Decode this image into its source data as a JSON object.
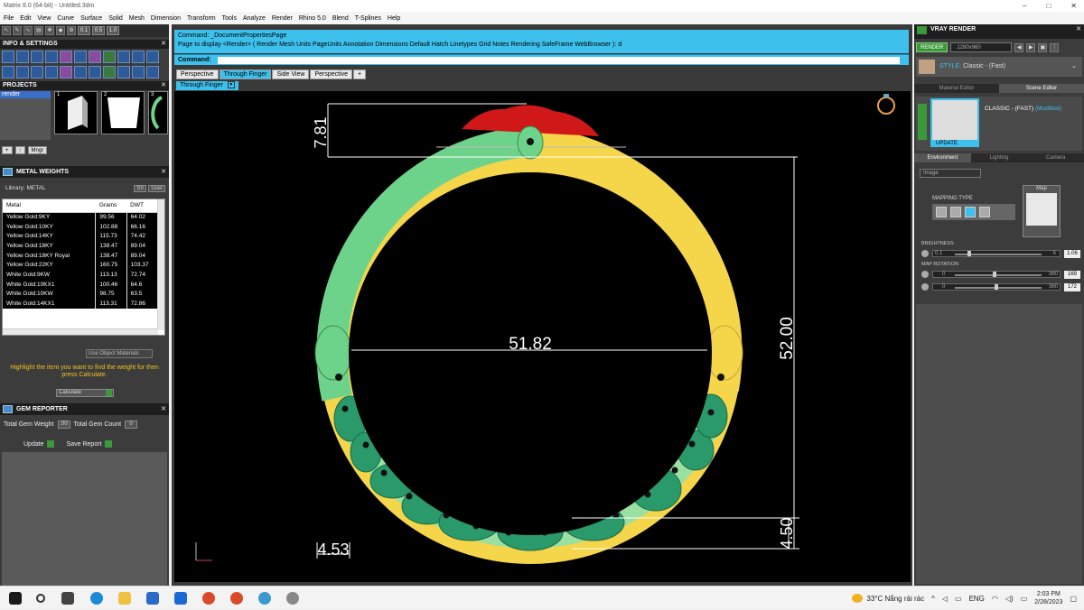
{
  "window": {
    "title": "Matrix 8.0 (64-bit) - Untitled.3dm",
    "controls": [
      "–",
      "□",
      "✕"
    ]
  },
  "menu": [
    "File",
    "Edit",
    "View",
    "Curve",
    "Surface",
    "Solid",
    "Mesh",
    "Dimension",
    "Transform",
    "Tools",
    "Analyze",
    "Render",
    "Rhino 5.0",
    "Blend",
    "T-Splines",
    "Help"
  ],
  "left_toolbar": {
    "nums": [
      "0.1",
      "0.5",
      "1.0"
    ]
  },
  "info_settings": {
    "title": "INFO & SETTINGS"
  },
  "projects": {
    "title": "PROJECTS",
    "selected_item": "render",
    "thumbs": [
      {
        "index": "1"
      },
      {
        "index": "2"
      },
      {
        "index": "3"
      }
    ],
    "mngr_label": "Mngr"
  },
  "metal_weights": {
    "title": "METAL WEIGHTS",
    "library_label": "Library: METAL",
    "sv_label": "SV",
    "user_label": "User",
    "columns": [
      "Metal",
      "Grams",
      "DWT"
    ],
    "rows": [
      [
        "Yellow Gold:9KY",
        "99.56",
        "64.02"
      ],
      [
        "Yellow Gold:10KY",
        "102.88",
        "66.16"
      ],
      [
        "Yellow Gold:14KY",
        "115.73",
        "74.42"
      ],
      [
        "Yellow Gold:18KY",
        "138.47",
        "89.04"
      ],
      [
        "Yellow Gold:18KY Royal",
        "138.47",
        "89.04"
      ],
      [
        "Yellow Gold:22KY",
        "160.75",
        "103.37"
      ],
      [
        "White Gold:9KW",
        "113.13",
        "72.74"
      ],
      [
        "White Gold:10KX1",
        "100.46",
        "64.6"
      ],
      [
        "White Gold:10KW",
        "98.75",
        "63.5"
      ],
      [
        "White Gold:14KX1",
        "113.31",
        "72.86"
      ]
    ],
    "use_object_materials": "Use Object Materials",
    "hint": "Highlight the item you want to find the weight for then press Calculate.",
    "calculate": "Calculate"
  },
  "gem_reporter": {
    "title": "GEM REPORTER",
    "total_gem_weight_label": "Total Gem Weight",
    "total_gem_weight": ".00",
    "total_gem_count_label": "Total Gem Count",
    "total_gem_count": "0",
    "update": "Update",
    "save_report": "Save Report"
  },
  "command": {
    "line1": "Command: _DocumentPropertiesPage",
    "line2": "Page to display <Render> ( Render  Mesh  Units  PageUnits  Annotation  Dimensions  Default  Hatch  Linetypes  Grid  Notes  Rendering  SafeFrame  WebBrowser ): d",
    "prompt": "Command:"
  },
  "viewport_tabs": [
    "Perspective",
    "Through Finger",
    "Side View",
    "Perspective",
    "+"
  ],
  "viewport_active_tab_index": 1,
  "viewport_title": "Through Finger",
  "dimensions": {
    "top_height": "7.81",
    "inner_diameter": "51.82",
    "outer_height": "52.00",
    "bottom_thickness": "4.50",
    "side_width": "4.53"
  },
  "colors": {
    "band_green": "#6ed38a",
    "band_yellow": "#f5d54a",
    "stone_green": "#2a9a6a",
    "head_red": "#d01818",
    "accent_cyan": "#3ec0ec"
  },
  "vray": {
    "title": "VRAY RENDER",
    "render_button": "RENDER",
    "resolution": "1280x960",
    "style_label": "STYLE:",
    "style_value": "Classic - (Fast)",
    "tabs": [
      "Material Editor",
      "Scene Editor"
    ],
    "active_tab_index": 1,
    "scene_name": "CLASSIC - (FAST)",
    "scene_modified": "(Modified)",
    "update": "UPDATE",
    "env_tabs": [
      "Environment",
      "Lighting",
      "Camera"
    ],
    "env_active_index": 0,
    "image_select": "Image",
    "mapping_type_label": "MAPPING TYPE",
    "map_label": "Map",
    "brightness_label": "BRIGHTNESS",
    "brightness_min": "0.1",
    "brightness_max": "5",
    "brightness_value": "1.06",
    "map_rotation_label": "MAP ROTATION",
    "rot1_min": "0",
    "rot1_max": "360",
    "rot1_value": "169",
    "rot2_min": "0",
    "rot2_max": "360",
    "rot2_value": "172"
  },
  "taskbar": {
    "weather": "33°C  Nắng rải rác",
    "lang": "ENG",
    "time": "2:03 PM",
    "date": "2/28/2023"
  }
}
